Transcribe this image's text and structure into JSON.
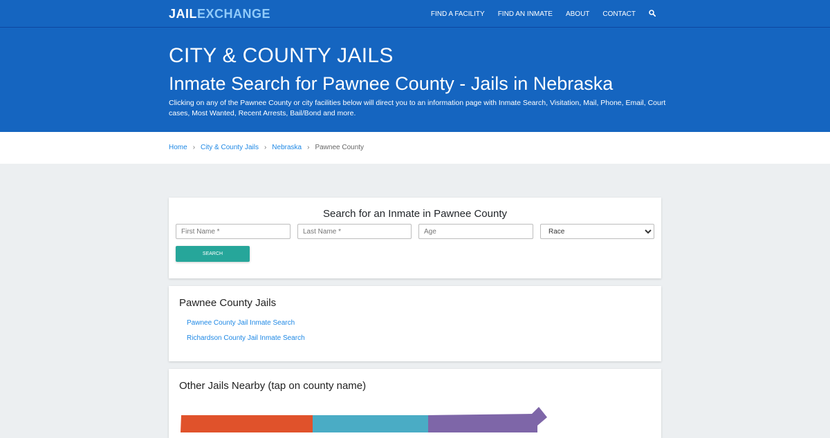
{
  "brand": {
    "part1": "JAIL",
    "part2": "EXCHANGE"
  },
  "nav": {
    "items": [
      {
        "label": "FIND A FACILITY"
      },
      {
        "label": "FIND AN INMATE"
      },
      {
        "label": "ABOUT"
      },
      {
        "label": "CONTACT"
      }
    ],
    "search_icon": "search-icon"
  },
  "hero": {
    "kicker": "CITY & COUNTY JAILS",
    "title": "Inmate Search for Pawnee County - Jails in Nebraska",
    "description": "Clicking on any of the Pawnee County or city facilities below will direct you to an information page with Inmate Search, Visitation, Mail, Phone, Email, Court cases, Most Wanted, Recent Arrests, Bail/Bond and more."
  },
  "breadcrumb": [
    "Home",
    "City & County Jails",
    "Nebraska",
    "Pawnee County"
  ],
  "search": {
    "title": "Search for an Inmate in Pawnee County",
    "first_name_placeholder": "First Name *",
    "last_name_placeholder": "Last Name *",
    "age_placeholder": "Age",
    "race_selected": "Race",
    "button_label": "SEARCH"
  },
  "jails": {
    "heading": "Pawnee County Jails",
    "links": [
      "Pawnee County Jail Inmate Search",
      "Richardson County Jail Inmate Search"
    ]
  },
  "nearby": {
    "heading": "Other Jails Nearby (tap on county name)",
    "colors": [
      "#e0522b",
      "#4aacc5",
      "#7e66a8"
    ]
  },
  "colors": {
    "primary": "#1565c0",
    "accent": "#26a69a",
    "link": "#1e88e5"
  }
}
